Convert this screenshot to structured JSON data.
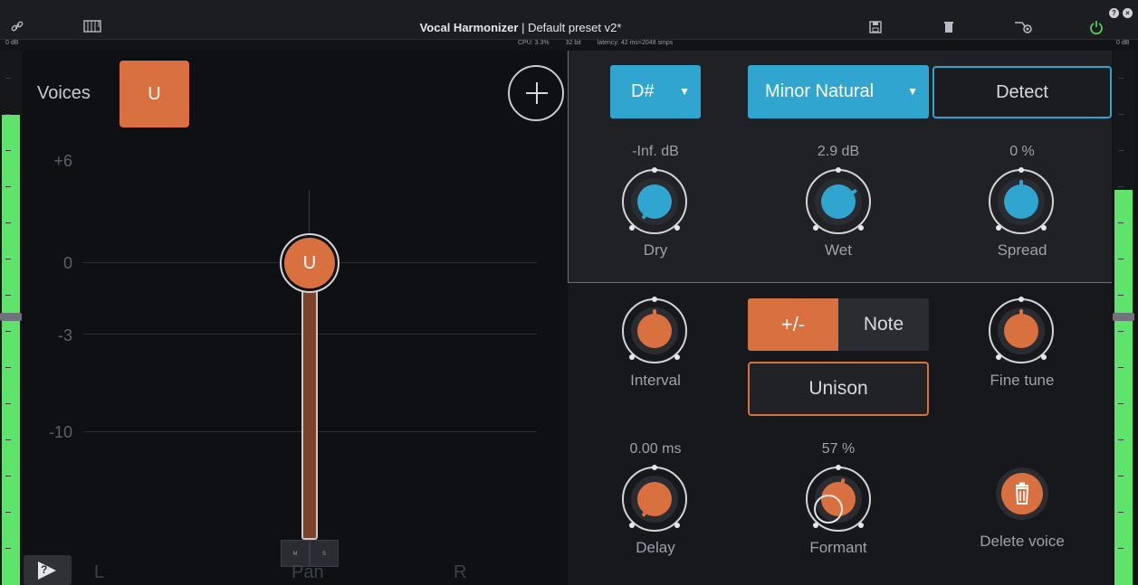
{
  "app": {
    "title": "Vocal Harmonizer",
    "separator": " | ",
    "preset": "Default preset v2*"
  },
  "toolbar": {
    "icons": [
      "link-icon",
      "keyboard-icon",
      "save-icon",
      "trash-icon",
      "routing-icon",
      "power-icon"
    ],
    "cpu": "CPU: 3.3%",
    "bits": "32 bit",
    "latency": "latency: 42 ms=2048 smps",
    "left_db": "0 dB",
    "right_db": "0 dB",
    "window_controls": [
      "?",
      "×"
    ]
  },
  "colors": {
    "accent_orange": "#d9703f",
    "accent_blue": "#2fa5cf",
    "meter_green": "#5ee36b"
  },
  "meters": {
    "left_level": 0.88,
    "right_level": 0.74
  },
  "voices": {
    "label": "Voices",
    "selected_voice": "U",
    "db_scale": [
      "+6",
      "0",
      "-3",
      "-10"
    ],
    "fader_knob_label": "U",
    "mute_label": "M",
    "solo_label": "S",
    "pan_left": "L",
    "pan_label": "Pan",
    "pan_right": "R"
  },
  "global": {
    "key": "D#",
    "scale": "Minor Natural",
    "detect_label": "Detect",
    "dry": {
      "value": "-Inf. dB",
      "label": "Dry"
    },
    "wet": {
      "value": "2.9 dB",
      "label": "Wet"
    },
    "spread": {
      "value": "0 %",
      "label": "Spread"
    }
  },
  "voice_settings": {
    "interval_label": "Interval",
    "sign_label": "+/-",
    "note_label": "Note",
    "unison_label": "Unison",
    "fine_tune_label": "Fine tune",
    "delay": {
      "value": "0.00 ms",
      "label": "Delay"
    },
    "formant": {
      "value": "57 %",
      "label": "Formant"
    },
    "delete_label": "Delete voice"
  }
}
